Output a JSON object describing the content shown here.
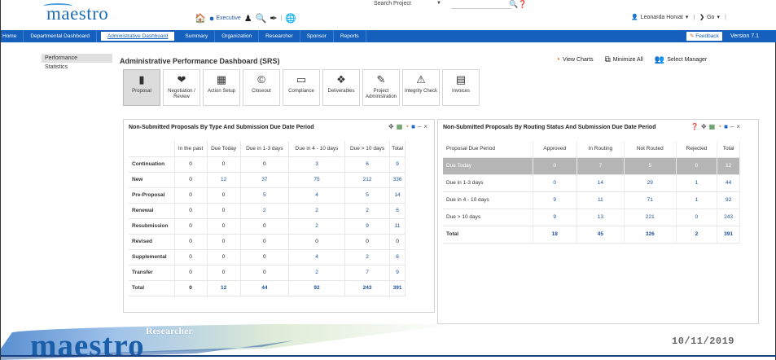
{
  "header": {
    "logo": "maestro",
    "executive_label": "Executive",
    "search_label": "Search",
    "search_scope": "Project",
    "search_value": "",
    "user_name": "Leonarda Horvat",
    "go_label": "Go"
  },
  "nav": {
    "items": [
      {
        "label": "Home"
      },
      {
        "label": "Departmental Dashboard"
      },
      {
        "label": "Administrative Dashboard"
      },
      {
        "label": "Summary"
      },
      {
        "label": "Organization"
      },
      {
        "label": "Researcher"
      },
      {
        "label": "Sponsor"
      },
      {
        "label": "Reports"
      }
    ],
    "feedback_label": "Feedback",
    "version_label": "Version 7.1"
  },
  "sidebar": {
    "items": [
      {
        "label": "Performance"
      },
      {
        "label": "Statistics"
      }
    ]
  },
  "page": {
    "title": "Administrative Performance Dashboard (SRS)",
    "view_charts": "View Charts",
    "minimize_all": "Minimize All",
    "select_manager": "Select Manager"
  },
  "tiles": [
    {
      "label": "Proposal",
      "icon": "briefcase-icon",
      "glyph": "💼"
    },
    {
      "label": "Negotiation / Review",
      "icon": "handshake-icon",
      "glyph": "⚖"
    },
    {
      "label": "Action Setup",
      "icon": "folder-icon",
      "glyph": "🗂"
    },
    {
      "label": "Closeout",
      "icon": "copyright-icon",
      "glyph": "©"
    },
    {
      "label": "Compliance",
      "icon": "document-icon",
      "glyph": "📄"
    },
    {
      "label": "Deliverables",
      "icon": "box-icon",
      "glyph": "❖"
    },
    {
      "label": "Project Administration",
      "icon": "edit-icon",
      "glyph": "✎"
    },
    {
      "label": "Integrity Check",
      "icon": "warning-icon",
      "glyph": "⚠"
    },
    {
      "label": "Invoices",
      "icon": "invoice-icon",
      "glyph": "🗎"
    }
  ],
  "panel_left": {
    "title": "Non-Submitted Proposals By Type And Submission Due Date Period",
    "columns": [
      "",
      "In the past",
      "Due Today",
      "Due in 1-3 days",
      "Due in 4 - 10 days",
      "Due > 10 days",
      "Total"
    ],
    "rows": [
      {
        "label": "Continuation",
        "values": [
          "0",
          "0",
          "0",
          "3",
          "6",
          "9"
        ]
      },
      {
        "label": "New",
        "values": [
          "0",
          "12",
          "37",
          "75",
          "212",
          "336"
        ]
      },
      {
        "label": "Pre-Proposal",
        "values": [
          "0",
          "0",
          "5",
          "4",
          "5",
          "14"
        ]
      },
      {
        "label": "Renewal",
        "values": [
          "0",
          "0",
          "2",
          "2",
          "2",
          "6"
        ]
      },
      {
        "label": "Resubmission",
        "values": [
          "0",
          "0",
          "0",
          "2",
          "9",
          "11"
        ]
      },
      {
        "label": "Revised",
        "values": [
          "0",
          "0",
          "0",
          "0",
          "0",
          "0"
        ]
      },
      {
        "label": "Supplemental",
        "values": [
          "0",
          "0",
          "0",
          "4",
          "2",
          "6"
        ]
      },
      {
        "label": "Transfer",
        "values": [
          "0",
          "0",
          "0",
          "2",
          "7",
          "9"
        ]
      },
      {
        "label": "Total",
        "values": [
          "0",
          "12",
          "44",
          "92",
          "243",
          "391"
        ]
      }
    ]
  },
  "panel_right": {
    "title": "Non-Submitted Proposals By Routing Status And Submission Due Date Period",
    "columns": [
      "Proposal Due Period",
      "Approved",
      "In Routing",
      "Not Routed",
      "Rejected",
      "Total"
    ],
    "rows": [
      {
        "label": "Due Today",
        "values": [
          "0",
          "7",
          "5",
          "0",
          "12"
        ]
      },
      {
        "label": "Due in 1-3 days",
        "values": [
          "0",
          "14",
          "29",
          "1",
          "44"
        ]
      },
      {
        "label": "Due in 4 - 10 days",
        "values": [
          "9",
          "11",
          "71",
          "1",
          "92"
        ]
      },
      {
        "label": "Due > 10 days",
        "values": [
          "9",
          "13",
          "221",
          "0",
          "243"
        ]
      },
      {
        "label": "Total",
        "values": [
          "18",
          "45",
          "326",
          "2",
          "391"
        ]
      }
    ]
  },
  "footer": {
    "logo": "maestro",
    "product": "Researcher",
    "date": "10/11/2019"
  },
  "colors": {
    "nav_blue": "#1560bd",
    "link_blue": "#1a4f9a",
    "highlight_row": "#b5b5b5",
    "footer_navy": "#1a3f80"
  }
}
